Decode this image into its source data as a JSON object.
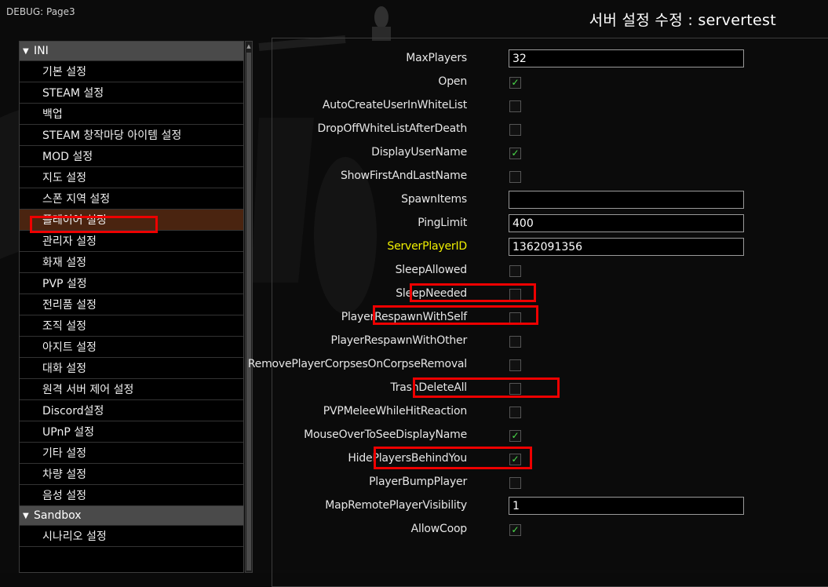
{
  "debug_label": "DEBUG: Page3",
  "window_title": "서버 설정 수정 : servertest",
  "sidebar": {
    "sections": [
      {
        "name": "INI",
        "items": [
          "기본 설정",
          "STEAM 설정",
          "백업",
          "STEAM 창작마당 아이템 설정",
          "MOD 설정",
          "지도 설정",
          "스폰 지역 설정",
          "플레이어 설정",
          "관리자 설정",
          "화재 설정",
          "PVP 설정",
          "전리품 설정",
          "조직 설정",
          "아지트 설정",
          "대화 설정",
          "원격 서버 제어 설정",
          "Discord설정",
          "UPnP 설정",
          "기타 설정",
          "차량 설정",
          "음성 설정"
        ]
      },
      {
        "name": "Sandbox",
        "items": [
          "시나리오 설정"
        ]
      }
    ],
    "selected": "플레이어 설정"
  },
  "settings": [
    {
      "label": "MaxPlayers",
      "type": "text",
      "value": "32"
    },
    {
      "label": "Open",
      "type": "check",
      "checked": true
    },
    {
      "label": "AutoCreateUserInWhiteList",
      "type": "check",
      "checked": false
    },
    {
      "label": "DropOffWhiteListAfterDeath",
      "type": "check",
      "checked": false
    },
    {
      "label": "DisplayUserName",
      "type": "check",
      "checked": true
    },
    {
      "label": "ShowFirstAndLastName",
      "type": "check",
      "checked": false
    },
    {
      "label": "SpawnItems",
      "type": "text",
      "value": ""
    },
    {
      "label": "PingLimit",
      "type": "text",
      "value": "400"
    },
    {
      "label": "ServerPlayerID",
      "type": "text",
      "value": "1362091356",
      "highlight_color": "#f0f000"
    },
    {
      "label": "SleepAllowed",
      "type": "check",
      "checked": false
    },
    {
      "label": "SleepNeeded",
      "type": "check",
      "checked": false
    },
    {
      "label": "PlayerRespawnWithSelf",
      "type": "check",
      "checked": false
    },
    {
      "label": "PlayerRespawnWithOther",
      "type": "check",
      "checked": false
    },
    {
      "label": "RemovePlayerCorpsesOnCorpseRemoval",
      "type": "check",
      "checked": false
    },
    {
      "label": "TrashDeleteAll",
      "type": "check",
      "checked": false
    },
    {
      "label": "PVPMeleeWhileHitReaction",
      "type": "check",
      "checked": false
    },
    {
      "label": "MouseOverToSeeDisplayName",
      "type": "check",
      "checked": true
    },
    {
      "label": "HidePlayersBehindYou",
      "type": "check",
      "checked": true
    },
    {
      "label": "PlayerBumpPlayer",
      "type": "check",
      "checked": false
    },
    {
      "label": "MapRemotePlayerVisibility",
      "type": "text",
      "value": "1"
    },
    {
      "label": "AllowCoop",
      "type": "check",
      "checked": true
    }
  ],
  "icons": {
    "section_expanded": "triangle-down-icon",
    "checkbox_checked": "checkmark-icon",
    "scroll_up": "scroll-up-arrow-icon"
  },
  "colors": {
    "annotation_red": "#ee0000",
    "selected_item": "#4a2410",
    "check_green": "#4ce04c"
  }
}
